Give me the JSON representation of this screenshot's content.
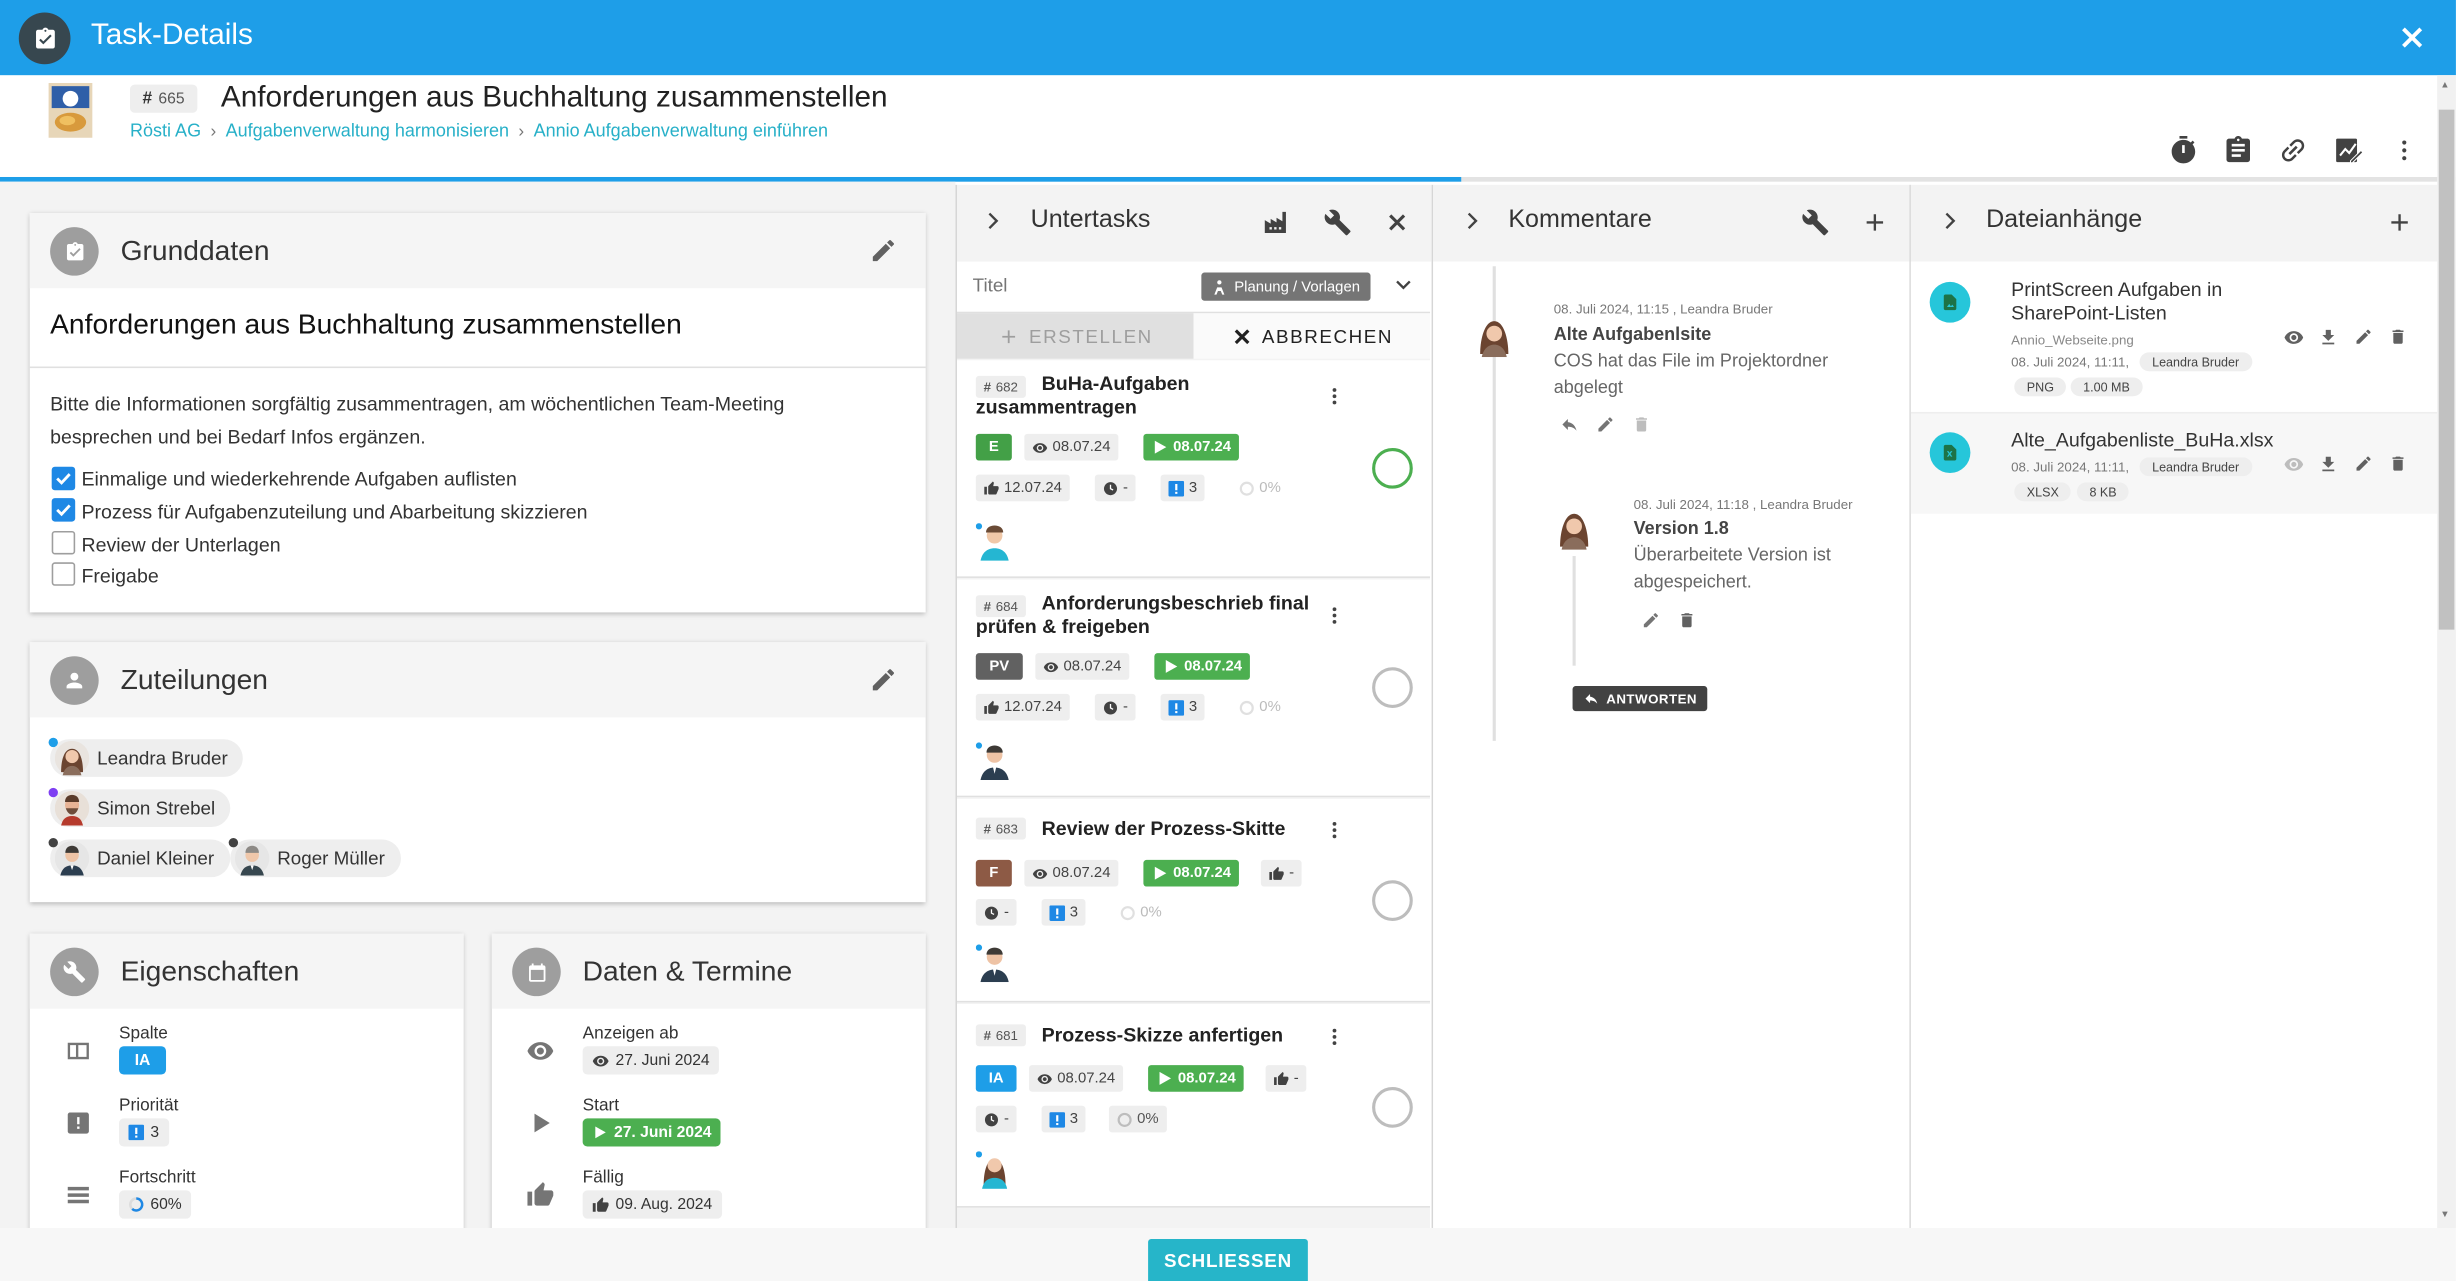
{
  "window": {
    "title": "Task-Details"
  },
  "task": {
    "id_prefix": "#",
    "id": "665",
    "title": "Anforderungen aus Buchhaltung zusammenstellen",
    "breadcrumbs": [
      "Rösti AG",
      "Aufgabenverwaltung harmonisieren",
      "Annio Aufgabenverwaltung einführen"
    ],
    "progress_percent": 59.5
  },
  "header_icons": [
    "timer-icon",
    "clipboard-icon",
    "link-icon",
    "signature-icon",
    "more-vert-icon"
  ],
  "grunddaten": {
    "header": "Grunddaten",
    "title": "Anforderungen aus Buchhaltung zusammenstellen",
    "description": "Bitte die Informationen sorgfältig zusammentragen, am wöchentlichen Team-Meeting besprechen und bei Bedarf Infos ergänzen.",
    "checklist": [
      {
        "label": "Einmalige und wiederkehrende Aufgaben auflisten",
        "checked": true
      },
      {
        "label": "Prozess für Aufgabenzuteilung und Abarbeitung skizzieren",
        "checked": true
      },
      {
        "label": "Review der Unterlagen",
        "checked": false
      },
      {
        "label": "Freigabe",
        "checked": false
      }
    ]
  },
  "zuteilungen": {
    "header": "Zuteilungen",
    "people": [
      {
        "name": "Leandra Bruder",
        "dot": "#1e9ee8"
      },
      {
        "name": "Simon Strebel",
        "dot": "#7e3ff2"
      },
      {
        "name": "Daniel Kleiner",
        "dot": "#424242"
      },
      {
        "name": "Roger Müller",
        "dot": "#424242"
      }
    ]
  },
  "eigenschaften": {
    "header": "Eigenschaften",
    "spalte_label": "Spalte",
    "spalte_value": "IA",
    "prioritaet_label": "Priorität",
    "prioritaet_value": "3",
    "fortschritt_label": "Fortschritt",
    "fortschritt_value": "60%"
  },
  "termine": {
    "header": "Daten & Termine",
    "anzeigen_label": "Anzeigen ab",
    "anzeigen_value": "27. Juni 2024",
    "start_label": "Start",
    "start_value": "27. Juni 2024",
    "faellig_label": "Fällig",
    "faellig_value": "09. Aug. 2024"
  },
  "untertasks": {
    "header": "Untertasks",
    "input_placeholder": "Titel",
    "planung_label": "Planung / Vorlagen",
    "create_label": "ERSTELLEN",
    "cancel_label": "ABBRECHEN",
    "items": [
      {
        "id": "682",
        "title_line1": "BuHa-Aufgaben",
        "title_line2": "zusammentragen",
        "col": "E",
        "col_color": "#43a047",
        "view": "08.07.24",
        "start": "08.07.24",
        "due": "12.07.24",
        "time": "-",
        "prio": "3",
        "progress": "0%",
        "ring": "#4caf50"
      },
      {
        "id": "684",
        "title_line1": "Anforderungsbeschrieb final",
        "title_line2": "prüfen & freigeben",
        "col": "PV",
        "col_color": "#616161",
        "view": "08.07.24",
        "start": "08.07.24",
        "due": "12.07.24",
        "time": "-",
        "prio": "3",
        "progress": "0%",
        "ring": "#bdbdbd"
      },
      {
        "id": "683",
        "title_line1": "Review der Prozess-Skitte",
        "title_line2": "",
        "col": "F",
        "col_color": "#8d5a45",
        "view": "08.07.24",
        "start": "08.07.24",
        "due": "-",
        "time": "-",
        "prio": "3",
        "progress": "0%",
        "ring": "#bdbdbd"
      },
      {
        "id": "681",
        "title_line1": "Prozess-Skizze anfertigen",
        "title_line2": "",
        "col": "IA",
        "col_color": "#1e9ee8",
        "view": "08.07.24",
        "start": "08.07.24",
        "due": "-",
        "time": "-",
        "prio": "3",
        "progress": "0%",
        "ring": "#bdbdbd"
      }
    ]
  },
  "kommentare": {
    "header": "Kommentare",
    "reply_label": "ANTWORTEN",
    "items": [
      {
        "meta_date": "08. Juli 2024, 11:15",
        "meta_author": "Leandra Bruder",
        "title": "Alte Aufgabenlsite",
        "text": "COS hat das File im Projektordner abgelegt"
      },
      {
        "meta_date": "08. Juli 2024, 11:18",
        "meta_author": "Leandra Bruder",
        "title": "Version 1.8",
        "text": "Überarbeitete Version ist abgespeichert."
      }
    ]
  },
  "dateien": {
    "header": "Dateianhänge",
    "items": [
      {
        "name_line1": "PrintScreen Aufgaben in",
        "name_line2": "SharePoint-Listen",
        "sub": "Annio_Webseite.png",
        "date": "08. Juli 2024, 11:11,",
        "author": "Leandra Bruder",
        "type": "PNG",
        "size": "1.00 MB"
      },
      {
        "name_line1": "Alte_Aufgabenliste_BuHa.xlsx",
        "name_line2": "",
        "sub": "",
        "date": "08. Juli 2024, 11:11,",
        "author": "Leandra Bruder",
        "type": "XLSX",
        "size": "8 KB"
      }
    ]
  },
  "footer": {
    "close_label": "SCHLIESSEN"
  }
}
